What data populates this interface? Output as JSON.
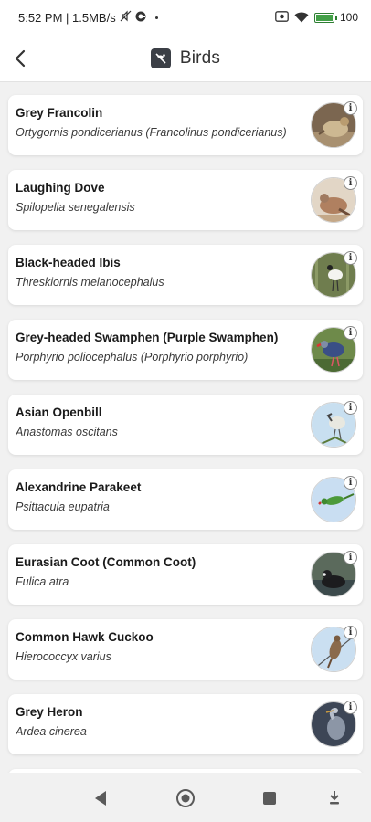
{
  "status_bar": {
    "time_info": "5:52 PM | 1.5MB/s",
    "battery": "100"
  },
  "app_bar": {
    "title": "Birds"
  },
  "birds": [
    {
      "name": "Grey Francolin",
      "scientific": "Ortygornis pondicerianus (Francolinus pondicerianus)",
      "thumb": "francolin"
    },
    {
      "name": "Laughing Dove",
      "scientific": "Spilopelia senegalensis",
      "thumb": "dove"
    },
    {
      "name": "Black-headed Ibis",
      "scientific": "Threskiornis melanocephalus",
      "thumb": "ibis"
    },
    {
      "name": "Grey-headed Swamphen (Purple Swamphen)",
      "scientific": "Porphyrio poliocephalus (Porphyrio porphyrio)",
      "thumb": "swamphen"
    },
    {
      "name": "Asian Openbill",
      "scientific": "Anastomas oscitans",
      "thumb": "openbill"
    },
    {
      "name": "Alexandrine Parakeet",
      "scientific": "Psittacula eupatria",
      "thumb": "parakeet"
    },
    {
      "name": "Eurasian Coot (Common Coot)",
      "scientific": "Fulica atra",
      "thumb": "coot"
    },
    {
      "name": "Common Hawk Cuckoo",
      "scientific": "Hierococcyx varius",
      "thumb": "cuckoo"
    },
    {
      "name": "Grey Heron",
      "scientific": "Ardea cinerea",
      "thumb": "heron"
    }
  ],
  "info_label": "i"
}
